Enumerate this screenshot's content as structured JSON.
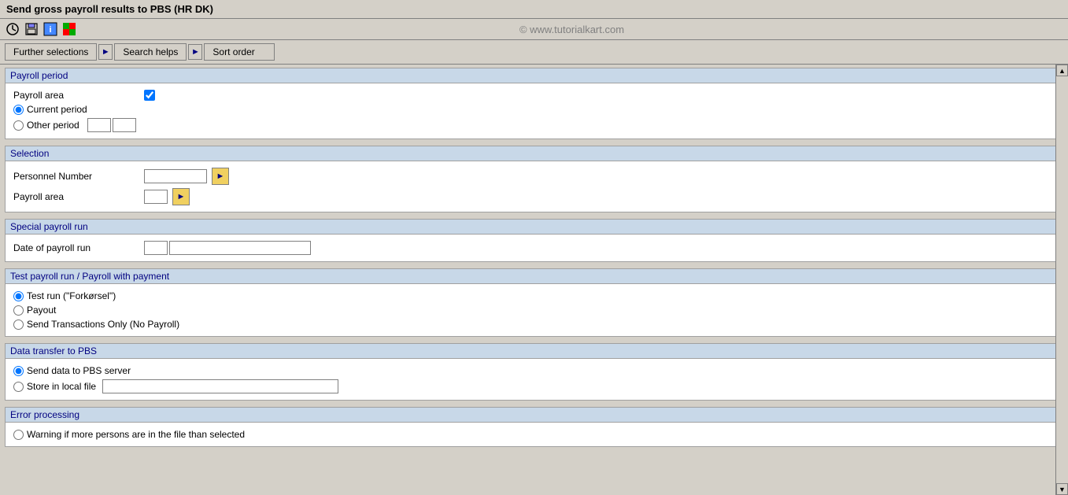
{
  "title": "Send gross payroll results to PBS (HR DK)",
  "watermark": "© www.tutorialkart.com",
  "toolbar": {
    "icons": [
      "clock-icon",
      "save-icon",
      "info-icon",
      "flag-icon"
    ]
  },
  "tabs": [
    {
      "id": "further-selections",
      "label": "Further selections"
    },
    {
      "id": "search-helps",
      "label": "Search helps"
    },
    {
      "id": "sort-order",
      "label": "Sort order"
    }
  ],
  "sections": {
    "payroll_period": {
      "header": "Payroll period",
      "payroll_area_label": "Payroll area",
      "current_period_label": "Current period",
      "other_period_label": "Other period"
    },
    "selection": {
      "header": "Selection",
      "personnel_number_label": "Personnel Number",
      "payroll_area_label": "Payroll area"
    },
    "special_payroll_run": {
      "header": "Special payroll run",
      "date_of_payroll_run_label": "Date of payroll run"
    },
    "test_payroll_run": {
      "header": "Test payroll run / Payroll with payment",
      "options": [
        {
          "label": "Test run (\"Forkørsel\")",
          "selected": true
        },
        {
          "label": "Payout",
          "selected": false
        },
        {
          "label": "Send Transactions Only (No Payroll)",
          "selected": false
        }
      ]
    },
    "data_transfer": {
      "header": "Data transfer to PBS",
      "options": [
        {
          "label": "Send data to PBS server",
          "selected": true
        },
        {
          "label": "Store in local file",
          "selected": false
        }
      ]
    },
    "error_processing": {
      "header": "Error processing",
      "options": [
        {
          "label": "Warning if more persons are in the file than selected",
          "selected": false
        }
      ]
    }
  }
}
